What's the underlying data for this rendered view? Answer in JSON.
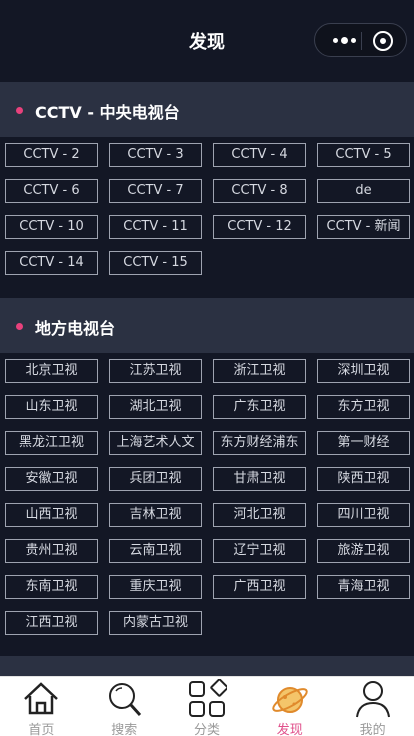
{
  "header": {
    "title": "发现"
  },
  "sections": [
    {
      "title": "CCTV - 中央电视台",
      "items": [
        "CCTV - 2",
        "CCTV - 3",
        "CCTV - 4",
        "CCTV - 5",
        "CCTV - 6",
        "CCTV - 7",
        "CCTV - 8",
        "de",
        "CCTV - 10",
        "CCTV - 11",
        "CCTV - 12",
        "CCTV - 新闻",
        "CCTV - 14",
        "CCTV - 15"
      ]
    },
    {
      "title": "地方电视台",
      "items": [
        "北京卫视",
        "江苏卫视",
        "浙江卫视",
        "深圳卫视",
        "山东卫视",
        "湖北卫视",
        "广东卫视",
        "东方卫视",
        "黑龙江卫视",
        "上海艺术人文",
        "东方财经浦东",
        "第一财经",
        "安徽卫视",
        "兵团卫视",
        "甘肃卫视",
        "陕西卫视",
        "山西卫视",
        "吉林卫视",
        "河北卫视",
        "四川卫视",
        "贵州卫视",
        "云南卫视",
        "辽宁卫视",
        "旅游卫视",
        "东南卫视",
        "重庆卫视",
        "广西卫视",
        "青海卫视",
        "江西卫视",
        "内蒙古卫视"
      ]
    }
  ],
  "tabbar": [
    {
      "label": "首页",
      "icon": "home-icon"
    },
    {
      "label": "搜索",
      "icon": "search-icon"
    },
    {
      "label": "分类",
      "icon": "category-icon"
    },
    {
      "label": "发现",
      "icon": "planet-icon"
    },
    {
      "label": "我的",
      "icon": "user-icon"
    }
  ],
  "colors": {
    "background": "#131725",
    "section": "#2b3142",
    "accent": "#e8417c",
    "active_tab": "#e04f8a"
  }
}
